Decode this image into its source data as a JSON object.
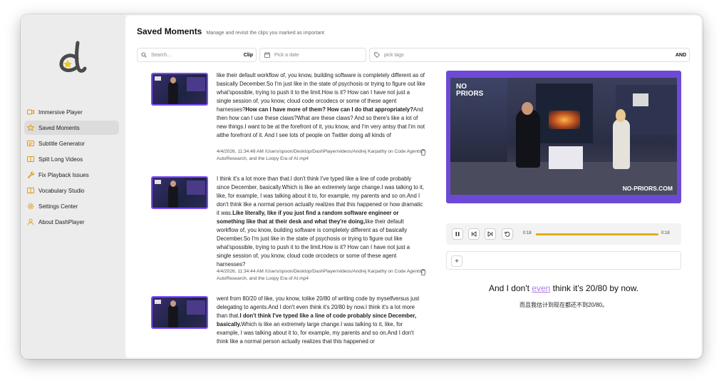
{
  "app": {
    "logo_letter": "d"
  },
  "sidebar": {
    "items": [
      {
        "label": "Immersive Player",
        "icon": "video-icon",
        "active": false
      },
      {
        "label": "Saved Moments",
        "icon": "star-icon",
        "active": true
      },
      {
        "label": "Subtitle Generator",
        "icon": "captions-icon",
        "active": false
      },
      {
        "label": "Split Long Videos",
        "icon": "split-icon",
        "active": false
      },
      {
        "label": "Fix Playback Issues",
        "icon": "wrench-icon",
        "active": false
      },
      {
        "label": "Vocabulary Studio",
        "icon": "book-icon",
        "active": false
      },
      {
        "label": "Settings Center",
        "icon": "gear-icon",
        "active": false
      },
      {
        "label": "About DashPlayer",
        "icon": "user-icon",
        "active": false
      }
    ]
  },
  "header": {
    "title": "Saved Moments",
    "subtitle": "Manage and revisit the clips you marked as important"
  },
  "filters": {
    "search_placeholder": "Search...",
    "clip_label": "Clip",
    "date_placeholder": "Pick a date",
    "tags_placeholder": "pick tags",
    "and_label": "AND"
  },
  "moments": [
    {
      "before": "like their default workflow of, you know, building software is completely different as of basically December.So I'm just like in the state of psychosis or trying to figure out like what'spossible, trying to push it to the limit.How is it? How can I have not just a single session of, you know, cloud code orcodecs or some of these agent harnesses?",
      "highlight": "How can I have more of them? How can I do that appropriately?",
      "after": "And then how can I use these claws?What are these claws? And so there's like a lot of new things.I want to be at the forefront of it, you know, and I'm very antsy that I'm not atthe forefront of it. And I see lots of people on Twitter doing all kinds of",
      "meta": "4/4/2026, 11:34:48 AM /Users/spoon/Desktop/DashPlayer/videos/Andrej Karpathy on Code Agents, AutoResearch, and the Loopy Era of AI.mp4"
    },
    {
      "before": "I think it's a lot more than that.I don't think I've typed like a line of code probably since December, basically.Which is like an extremely large change.I was talking to it, like, for example, I was talking about it to, for example, my parents and so on.And I don't think like a normal person actually realizes that this happened or how dramatic it was.",
      "highlight": "Like literally, like if you just find a random software engineer or something like that at their desk and what they're doing,",
      "after": "like their default workflow of, you know, building software is completely different as of basically December.So I'm just like in the state of psychosis or trying to figure out like what'spossible, trying to push it to the limit.How is it? How can I have not just a single session of, you know, cloud code orcodecs or some of these agent harnesses?",
      "meta": "4/4/2026, 11:34:44 AM /Users/spoon/Desktop/DashPlayer/videos/Andrej Karpathy on Code Agents, AutoResearch, and the Loopy Era of AI.mp4"
    },
    {
      "before": "went from 80/20 of like, you know, tolike 20/80 of writing code by myselfversus just delegating to agents.And I don't even think it's 20/80 by now.I think it's a lot more than that.",
      "highlight": "I don't think I've typed like a line of code probably since December, basically.",
      "after": "Which is like an extremely large change.I was talking to it, like, for example, I was talking about it to, for example, my parents and so on.And I don't think like a normal person actually realizes that this happened or",
      "meta": ""
    }
  ],
  "player": {
    "badge_line1": "NO",
    "badge_line2": "PRIORS",
    "watermark": "NO-PRIORS.COM",
    "time_current": "0:18",
    "time_total": "0:18",
    "progress": 1.0,
    "add_label": "+"
  },
  "subtitle": {
    "before": "And I don't ",
    "word": "even",
    "after": " think it's 20/80 by now.",
    "translation": "而且我估计到现在都还不到20/80。"
  },
  "colors": {
    "accent": "#7c4dff",
    "progress": "#f0c400"
  }
}
